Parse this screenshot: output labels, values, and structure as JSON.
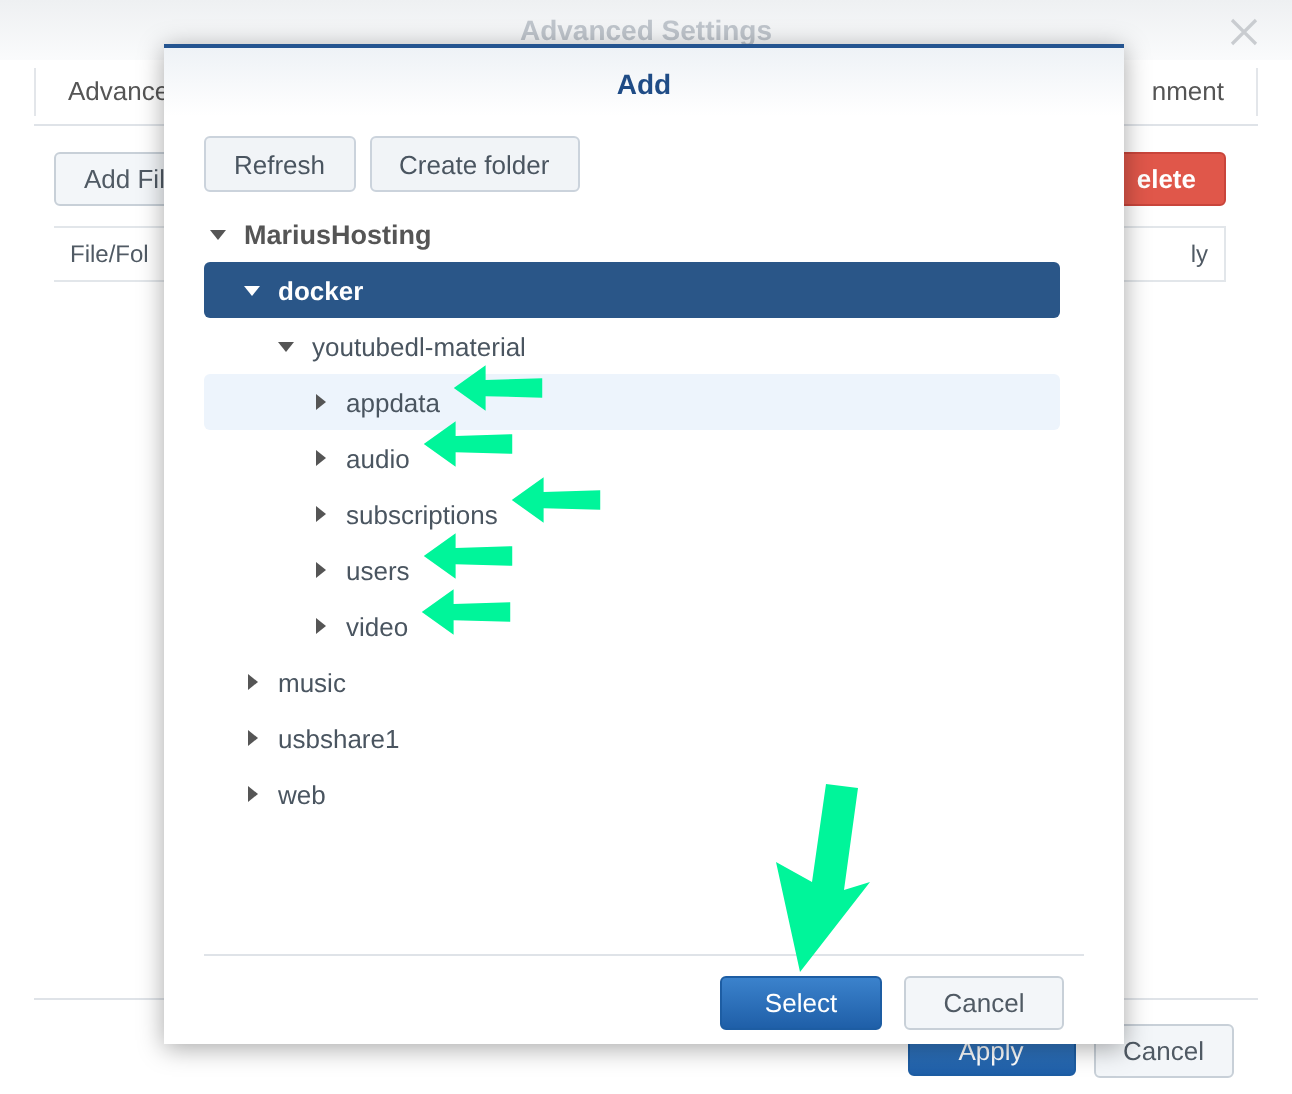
{
  "background_window": {
    "title": "Advanced Settings",
    "tabs": [
      {
        "label": "Advance",
        "selected": false
      },
      {
        "label": "nment",
        "selected": false
      }
    ],
    "toolbar": {
      "add_button": "Add Fil",
      "delete_button": "elete"
    },
    "table": {
      "columns": [
        "File/Fol",
        "ly"
      ]
    },
    "buttons": {
      "apply": "Apply",
      "cancel": "Cancel"
    }
  },
  "dialog": {
    "title": "Add",
    "toolbar": [
      "Refresh",
      "Create folder"
    ],
    "tree": [
      {
        "label": "MariusHosting",
        "expanded": true,
        "selected": false,
        "hovered": false,
        "marked": false,
        "children": [
          {
            "label": "docker",
            "expanded": true,
            "selected": true,
            "hovered": false,
            "marked": false,
            "children": [
              {
                "label": "youtubedl-material",
                "expanded": true,
                "selected": false,
                "hovered": false,
                "marked": false,
                "children": [
                  {
                    "label": "appdata",
                    "expanded": false,
                    "selected": false,
                    "hovered": true,
                    "marked": true
                  },
                  {
                    "label": "audio",
                    "expanded": false,
                    "selected": false,
                    "hovered": false,
                    "marked": true
                  },
                  {
                    "label": "subscriptions",
                    "expanded": false,
                    "selected": false,
                    "hovered": false,
                    "marked": true
                  },
                  {
                    "label": "users",
                    "expanded": false,
                    "selected": false,
                    "hovered": false,
                    "marked": true
                  },
                  {
                    "label": "video",
                    "expanded": false,
                    "selected": false,
                    "hovered": false,
                    "marked": true
                  }
                ]
              }
            ]
          },
          {
            "label": "music",
            "expanded": false,
            "selected": false,
            "hovered": false,
            "marked": false
          },
          {
            "label": "usbshare1",
            "expanded": false,
            "selected": false,
            "hovered": false,
            "marked": false
          },
          {
            "label": "web",
            "expanded": false,
            "selected": false,
            "hovered": false,
            "marked": false
          }
        ]
      }
    ],
    "footer": {
      "select": {
        "label": "Select",
        "marked": true
      },
      "cancel": "Cancel"
    }
  }
}
